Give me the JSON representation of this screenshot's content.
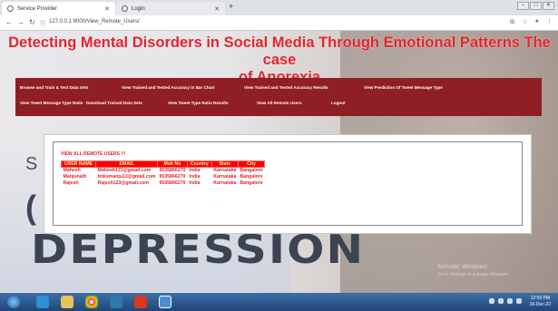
{
  "browser": {
    "tabs": [
      {
        "label": "Service Provider"
      },
      {
        "label": "Login"
      }
    ],
    "url": "127.0.0.1:8000/View_Remote_Users/"
  },
  "page": {
    "title_line1": "Detecting Mental Disorders in Social Media Through Emotional Patterns The case",
    "title_line2": "of Anorexia",
    "menu": [
      "Browse and Train & Test Data Sets",
      "View Trained and Tested Accuracy in Bar Chart",
      "View Trained and Tested Accuracy Results",
      "View Prediction Of Tweet Message Type",
      "View Tweet Message Type Ratio",
      "Download Trained Data Sets",
      "View Tweet Type Ratio Results",
      "View All Remote Users",
      "Logout"
    ],
    "background_text": "DEPRESSION",
    "panel": {
      "heading": "VIEW ALL REMOTE USERS !!!",
      "columns": [
        "USER NAME",
        "EMAIL",
        "Mob No",
        "Country",
        "State",
        "City"
      ],
      "rows": [
        [
          "Mahesh",
          "Mahesh123@gmail.com",
          "9535866270",
          "India",
          "Karnataka",
          "Bangalore"
        ],
        [
          "Manjunath",
          "tmksmanju13@gmail.com",
          "9535866270",
          "India",
          "Karnataka",
          "Bangalore"
        ],
        [
          "Rajesh",
          "Rajesh123@gmail.com",
          "9535866270",
          "India",
          "Karnataka",
          "Bangalore"
        ]
      ]
    },
    "watermark": "Activate Windows",
    "watermark_sub": "Go to Settings to activate Windows."
  },
  "taskbar": {
    "time": "12:59 PM",
    "date": "16-Dec-22"
  },
  "colors": {
    "title_red": "#e4232c",
    "menu_bg": "#8f1f24",
    "table_header": "#ff0000"
  }
}
